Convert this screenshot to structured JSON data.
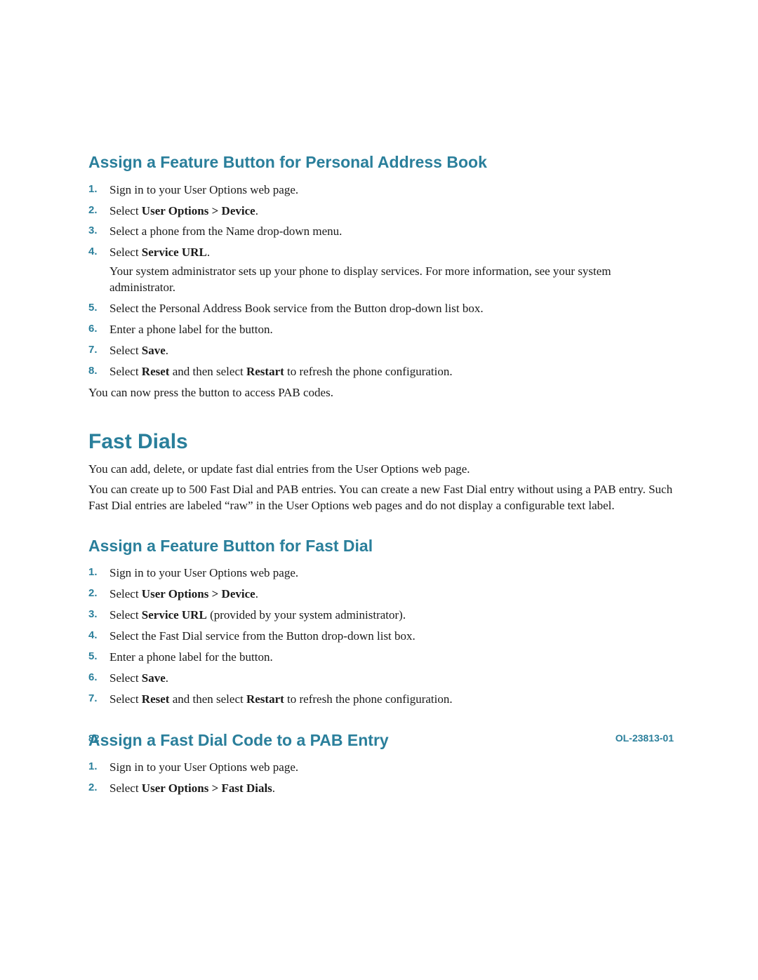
{
  "section1": {
    "heading": "Assign a Feature Button for Personal Address Book",
    "step1": "Sign in to your User Options web page.",
    "step2_prefix": "Select ",
    "step2_bold": "User Options > Device",
    "step2_suffix": ".",
    "step3": "Select a phone from the Name drop-down menu.",
    "step4_prefix": "Select ",
    "step4_bold": "Service URL",
    "step4_suffix": ".",
    "step4_note": "Your system administrator sets up your phone to display services. For more information, see your system administrator.",
    "step5": "Select the Personal Address Book service from the Button drop-down list box.",
    "step6": "Enter a phone label for the button.",
    "step7_prefix": "Select ",
    "step7_bold": "Save",
    "step7_suffix": ".",
    "step8_prefix": "Select ",
    "step8_bold1": "Reset",
    "step8_mid": " and then select ",
    "step8_bold2": "Restart",
    "step8_suffix": " to refresh the phone configuration.",
    "closing": "You can now press the button to access PAB codes."
  },
  "section2": {
    "heading": "Fast Dials",
    "para1": "You can add, delete, or update fast dial entries from the User Options web page.",
    "para2": "You can create up to 500 Fast Dial and PAB entries. You can create a new Fast Dial entry without using a PAB entry. Such Fast Dial entries are labeled “raw” in the User Options web pages and do not display a configurable text label."
  },
  "section3": {
    "heading": "Assign a Feature Button for Fast Dial",
    "step1": "Sign in to your User Options web page.",
    "step2_prefix": "Select ",
    "step2_bold": "User Options > Device",
    "step2_suffix": ".",
    "step3_prefix": "Select ",
    "step3_bold": "Service URL",
    "step3_suffix": " (provided by your system administrator).",
    "step4": "Select the Fast Dial service from the Button drop-down list box.",
    "step5": "Enter a phone label for the button.",
    "step6_prefix": "Select ",
    "step6_bold": "Save",
    "step6_suffix": ".",
    "step7_prefix": "Select ",
    "step7_bold1": "Reset",
    "step7_mid": " and then select ",
    "step7_bold2": "Restart",
    "step7_suffix": " to refresh the phone configuration."
  },
  "section4": {
    "heading": "Assign a Fast Dial Code to a PAB Entry",
    "step1": "Sign in to your User Options web page.",
    "step2_prefix": "Select ",
    "step2_bold": "User Options > Fast Dials",
    "step2_suffix": "."
  },
  "footer": {
    "page": "82",
    "docid": "OL-23813-01"
  }
}
